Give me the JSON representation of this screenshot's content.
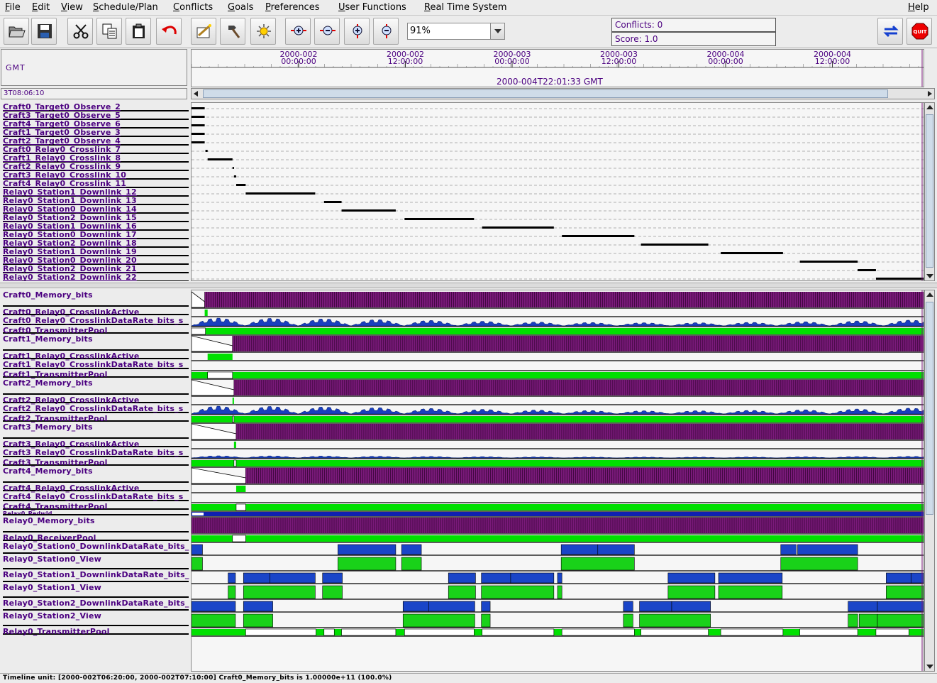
{
  "menu": {
    "items": [
      "File",
      "Edit",
      "View",
      "Schedule/Plan",
      "Conflicts",
      "Goals",
      "Preferences",
      "User Functions",
      "Real Time System"
    ],
    "underline": [
      "F",
      "E",
      "V",
      "S",
      "C",
      "G",
      "P",
      "U",
      "R"
    ],
    "help": "Help"
  },
  "toolbar": {
    "zoom_value": "91%",
    "conflicts": "Conflicts: 0",
    "score": "Score: 1.0",
    "icons": [
      "open-folder-icon",
      "save-disk-icon",
      "cut-scissors-icon",
      "copy-icon",
      "paste-clipboard-icon",
      "undo-arrow-icon",
      "schedule-wand-icon",
      "repair-hammer-icon",
      "optimize-sun-icon",
      "zoom-fit-icon",
      "zoom-in-icon",
      "zoom-out-time-icon",
      "zoom-out-icon",
      "swap-arrows-icon",
      "quit-stop-icon"
    ],
    "quit_label": "QUIT"
  },
  "timeline": {
    "timezone": "GMT",
    "cursor_time": "3T08:06:10",
    "current_time": "2000-004T22:01:33 GMT",
    "ticks": [
      {
        "date": "2000-002",
        "time": "00:00:00"
      },
      {
        "date": "2000-002",
        "time": "12:00:00"
      },
      {
        "date": "2000-003",
        "time": "00:00:00"
      },
      {
        "date": "2000-003",
        "time": "12:00:00"
      },
      {
        "date": "2000-004",
        "time": "00:00:00"
      },
      {
        "date": "2000-004",
        "time": "12:00:00"
      }
    ]
  },
  "activities": [
    {
      "name": "Craft0_Target0_Observe_2",
      "start": 0.0,
      "end": 0.018
    },
    {
      "name": "Craft3_Target0_Observe_5",
      "start": 0.0,
      "end": 0.018
    },
    {
      "name": "Craft4_Target0_Observe_6",
      "start": 0.0,
      "end": 0.018
    },
    {
      "name": "Craft1_Target0_Observe_3",
      "start": 0.0,
      "end": 0.018
    },
    {
      "name": "Craft2_Target0_Observe_4",
      "start": 0.0,
      "end": 0.018
    },
    {
      "name": "Craft0_Relay0_Crosslink_7",
      "start": 0.019,
      "end": 0.022
    },
    {
      "name": "Craft1_Relay0_Crosslink_8",
      "start": 0.022,
      "end": 0.056
    },
    {
      "name": "Craft2_Relay0_Crosslink_9",
      "start": 0.056,
      "end": 0.058
    },
    {
      "name": "Craft3_Relay0_Crosslink_10",
      "start": 0.058,
      "end": 0.061
    },
    {
      "name": "Craft4_Relay0_Crosslink_11",
      "start": 0.061,
      "end": 0.074
    },
    {
      "name": "Relay0_Station1_Downlink_12",
      "start": 0.074,
      "end": 0.169
    },
    {
      "name": "Relay0_Station1_Downlink_13",
      "start": 0.181,
      "end": 0.205
    },
    {
      "name": "Relay0_Station0_Downlink_14",
      "start": 0.205,
      "end": 0.279
    },
    {
      "name": "Relay0_Station2_Downlink_15",
      "start": 0.291,
      "end": 0.386
    },
    {
      "name": "Relay0_Station1_Downlink_16",
      "start": 0.397,
      "end": 0.495
    },
    {
      "name": "Relay0_Station0_Downlink_17",
      "start": 0.506,
      "end": 0.605
    },
    {
      "name": "Relay0_Station2_Downlink_18",
      "start": 0.614,
      "end": 0.706
    },
    {
      "name": "Relay0_Station1_Downlink_19",
      "start": 0.723,
      "end": 0.808
    },
    {
      "name": "Relay0_Station0_Downlink_20",
      "start": 0.831,
      "end": 0.91
    },
    {
      "name": "Relay0_Station2_Downlink_21",
      "start": 0.91,
      "end": 0.935
    },
    {
      "name": "Relay0_Station2_Downlink_22",
      "start": 0.935,
      "end": 1.0
    }
  ],
  "resources": [
    {
      "name": "Craft0_Memory_bits",
      "kind": "memory",
      "start": 0.018,
      "h": 22
    },
    {
      "name": "Craft0_Relay0_CrosslinkActive",
      "kind": "state",
      "on": [
        [
          0.018,
          0.022
        ]
      ],
      "h": 10
    },
    {
      "name": "Craft0_Relay0_CrosslinkDataRate_bits_s",
      "kind": "rate",
      "h": 12
    },
    {
      "name": "Craft0_TransmitterPool",
      "kind": "pool",
      "off": [
        [
          0.0,
          0.019
        ]
      ],
      "h": 10
    },
    {
      "name": "Craft1_Memory_bits",
      "kind": "memory",
      "start": 0.056,
      "h": 22
    },
    {
      "name": "Craft1_Relay0_CrosslinkActive",
      "kind": "state",
      "on": [
        [
          0.022,
          0.056
        ]
      ],
      "h": 10
    },
    {
      "name": "Craft1_Relay0_CrosslinkDataRate_bits_s",
      "kind": "empty",
      "h": 12
    },
    {
      "name": "Craft1_TransmitterPool",
      "kind": "pool",
      "off": [
        [
          0.022,
          0.056
        ]
      ],
      "h": 10
    },
    {
      "name": "Craft2_Memory_bits",
      "kind": "memory",
      "start": 0.058,
      "h": 22
    },
    {
      "name": "Craft2_Relay0_CrosslinkActive",
      "kind": "state",
      "on": [
        [
          0.056,
          0.058
        ]
      ],
      "h": 10
    },
    {
      "name": "Craft2_Relay0_CrosslinkDataRate_bits_s",
      "kind": "rate",
      "h": 12
    },
    {
      "name": "Craft2_TransmitterPool",
      "kind": "pool",
      "off": [
        [
          0.056,
          0.058
        ]
      ],
      "h": 10
    },
    {
      "name": "Craft3_Memory_bits",
      "kind": "memory",
      "start": 0.061,
      "h": 22
    },
    {
      "name": "Craft3_Relay0_CrosslinkActive",
      "kind": "state",
      "on": [
        [
          0.058,
          0.061
        ]
      ],
      "h": 10
    },
    {
      "name": "Craft3_Relay0_CrosslinkDataRate_bits_s",
      "kind": "rate_small",
      "h": 12
    },
    {
      "name": "Craft3_TransmitterPool",
      "kind": "pool",
      "off": [
        [
          0.058,
          0.061
        ]
      ],
      "h": 10
    },
    {
      "name": "Craft4_Memory_bits",
      "kind": "memory",
      "start": 0.074,
      "h": 22
    },
    {
      "name": "Craft4_Relay0_CrosslinkActive",
      "kind": "state",
      "on": [
        [
          0.061,
          0.074
        ]
      ],
      "h": 10
    },
    {
      "name": "Craft4_Relay0_CrosslinkDataRate_bits_s",
      "kind": "empty",
      "h": 12
    },
    {
      "name": "Craft4_TransmitterPool",
      "kind": "pool",
      "off": [
        [
          0.061,
          0.074
        ]
      ],
      "h": 10
    },
    {
      "name": "Relay0_Pedwld",
      "kind": "blue",
      "h": 6
    },
    {
      "name": "Relay0_Memory_bits",
      "kind": "memory",
      "start": 0.0,
      "h": 22
    },
    {
      "name": "Relay0_ReceiverPool",
      "kind": "pool",
      "off": [
        [
          0.056,
          0.074
        ]
      ],
      "h": 10
    },
    {
      "name": "Relay0_Station0_DownlinkDataRate_bits_",
      "kind": "downlink",
      "blocks": [
        [
          0.0,
          0.015
        ],
        [
          0.2,
          0.279
        ],
        [
          0.287,
          0.314
        ],
        [
          0.505,
          0.555
        ],
        [
          0.555,
          0.605
        ],
        [
          0.805,
          0.826
        ],
        [
          0.828,
          0.91
        ]
      ],
      "h": 16
    },
    {
      "name": "Relay0_Station0_View",
      "kind": "view",
      "blocks": [
        [
          0.0,
          0.015
        ],
        [
          0.2,
          0.279
        ],
        [
          0.287,
          0.314
        ],
        [
          0.505,
          0.605
        ],
        [
          0.805,
          0.91
        ]
      ],
      "h": 20
    },
    {
      "name": "Relay0_Station1_DownlinkDataRate_bits_",
      "kind": "downlink",
      "blocks": [
        [
          0.05,
          0.06
        ],
        [
          0.071,
          0.107
        ],
        [
          0.107,
          0.169
        ],
        [
          0.179,
          0.206
        ],
        [
          0.351,
          0.388
        ],
        [
          0.396,
          0.436
        ],
        [
          0.436,
          0.495
        ],
        [
          0.5,
          0.506
        ],
        [
          0.651,
          0.715
        ],
        [
          0.72,
          0.807
        ],
        [
          0.949,
          0.983
        ],
        [
          0.983,
          1.0
        ]
      ],
      "h": 16
    },
    {
      "name": "Relay0_Station1_View",
      "kind": "view",
      "blocks": [
        [
          0.05,
          0.06
        ],
        [
          0.071,
          0.169
        ],
        [
          0.179,
          0.206
        ],
        [
          0.351,
          0.388
        ],
        [
          0.396,
          0.495
        ],
        [
          0.5,
          0.506
        ],
        [
          0.651,
          0.715
        ],
        [
          0.72,
          0.807
        ],
        [
          0.949,
          1.0
        ]
      ],
      "h": 20
    },
    {
      "name": "Relay0_Station2_DownlinkDataRate_bits_",
      "kind": "downlink",
      "blocks": [
        [
          0.0,
          0.06
        ],
        [
          0.071,
          0.111
        ],
        [
          0.289,
          0.324
        ],
        [
          0.324,
          0.387
        ],
        [
          0.396,
          0.408
        ],
        [
          0.59,
          0.603
        ],
        [
          0.612,
          0.656
        ],
        [
          0.656,
          0.709
        ],
        [
          0.897,
          0.937
        ],
        [
          0.937,
          1.0
        ]
      ],
      "h": 16
    },
    {
      "name": "Relay0_Station2_View",
      "kind": "view",
      "blocks": [
        [
          0.0,
          0.06
        ],
        [
          0.071,
          0.111
        ],
        [
          0.289,
          0.387
        ],
        [
          0.396,
          0.408
        ],
        [
          0.59,
          0.603
        ],
        [
          0.612,
          0.709
        ],
        [
          0.897,
          0.91
        ],
        [
          0.912,
          0.937
        ],
        [
          0.937,
          1.0
        ]
      ],
      "h": 20
    },
    {
      "name": "Relay0_TransmitterPool",
      "kind": "pool",
      "off": [
        [
          0.074,
          0.17
        ],
        [
          0.181,
          0.195
        ],
        [
          0.205,
          0.279
        ],
        [
          0.291,
          0.386
        ],
        [
          0.397,
          0.495
        ],
        [
          0.506,
          0.605
        ],
        [
          0.614,
          0.706
        ],
        [
          0.723,
          0.808
        ],
        [
          0.831,
          0.91
        ],
        [
          0.935,
          0.98
        ]
      ],
      "h": 10
    }
  ],
  "colors": {
    "label": "#4b0080",
    "memory": "#7a1a7a",
    "rate": "#1a3fbf",
    "pool": "#00e000",
    "view": "#19d219",
    "downlink": "#1a45c8"
  },
  "status": "Timeline unit: [2000-002T06:20:00, 2000-002T07:10:00] Craft0_Memory_bits is 1.00000e+11  (100.0%)"
}
